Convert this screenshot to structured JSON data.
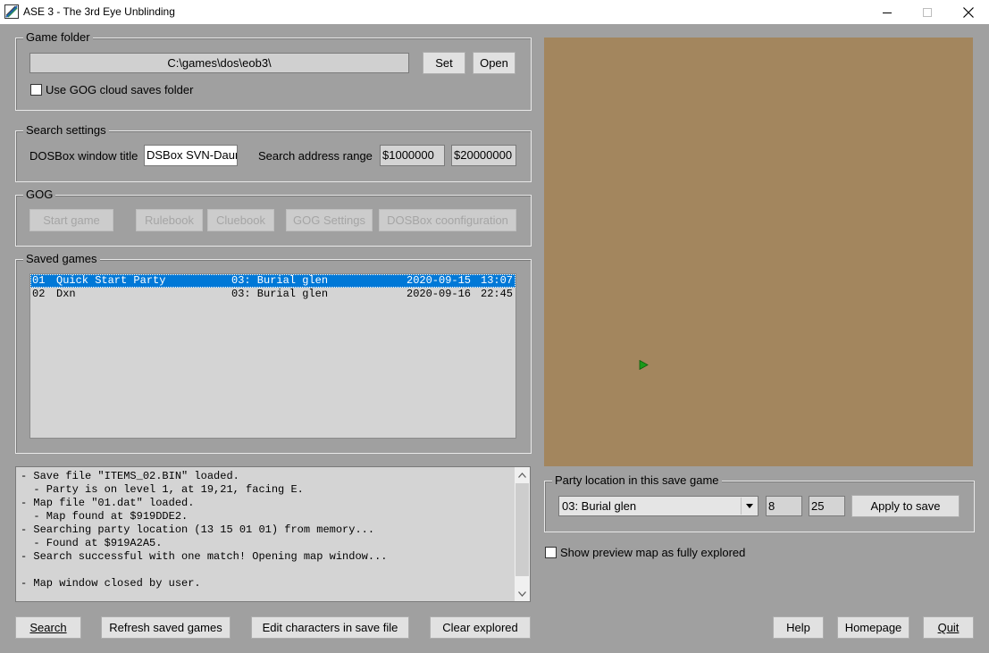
{
  "window": {
    "title": "ASE 3 - The 3rd Eye Unblinding"
  },
  "game_folder": {
    "group_label": "Game folder",
    "path": "C:\\games\\dos\\eob3\\",
    "set_label": "Set",
    "open_label": "Open",
    "gog_cloud_label": "Use GOG cloud saves folder",
    "gog_cloud_checked": false
  },
  "search_settings": {
    "group_label": "Search settings",
    "dosbox_title_label": "DOSBox window title",
    "dosbox_title_value": "DSBox SVN-Daum",
    "range_label": "Search address range",
    "range_start": "$1000000",
    "range_end": "$20000000"
  },
  "gog": {
    "group_label": "GOG",
    "start_game_label": "Start game",
    "rulebook_label": "Rulebook",
    "cluebook_label": "Cluebook",
    "settings_label": "GOG Settings",
    "dosbox_config_label": "DOSBox coonfiguration"
  },
  "saved_games": {
    "group_label": "Saved games",
    "rows": [
      {
        "slot": "01",
        "name": "Quick Start Party",
        "location": "03: Burial glen",
        "date": "2020-09-15",
        "time": "13:07",
        "selected": true
      },
      {
        "slot": "02",
        "name": "Dxn",
        "location": "03: Burial glen",
        "date": "2020-09-16",
        "time": "22:45",
        "selected": false
      }
    ]
  },
  "log": {
    "lines": [
      "- Save file \"ITEMS_02.BIN\" loaded.",
      "  - Party is on level 1, at 19,21, facing E.",
      "- Map file \"01.dat\" loaded.",
      "  - Map found at $919DDE2.",
      "- Searching party location (13 15 01 01) from memory...",
      "  - Found at $919A2A5.",
      "- Search successful with one match! Opening map window...",
      "",
      "- Map window closed by user."
    ]
  },
  "party_location": {
    "group_label": "Party location in this save game",
    "level_selected": "03: Burial glen",
    "x": "8",
    "y": "25",
    "apply_label": "Apply to save"
  },
  "preview": {
    "show_explored_label": "Show preview map as fully explored",
    "show_explored_checked": false
  },
  "bottom_buttons": {
    "search": "Search",
    "refresh": "Refresh saved games",
    "edit_chars": "Edit characters in save file",
    "clear_explored": "Clear explored",
    "help": "Help",
    "homepage": "Homepage",
    "quit": "Quit"
  },
  "colors": {
    "window_bg": "#a0a0a0",
    "map_bg": "#a3865e",
    "party_marker": "#1a9a1a",
    "selection": "#0078d7"
  }
}
